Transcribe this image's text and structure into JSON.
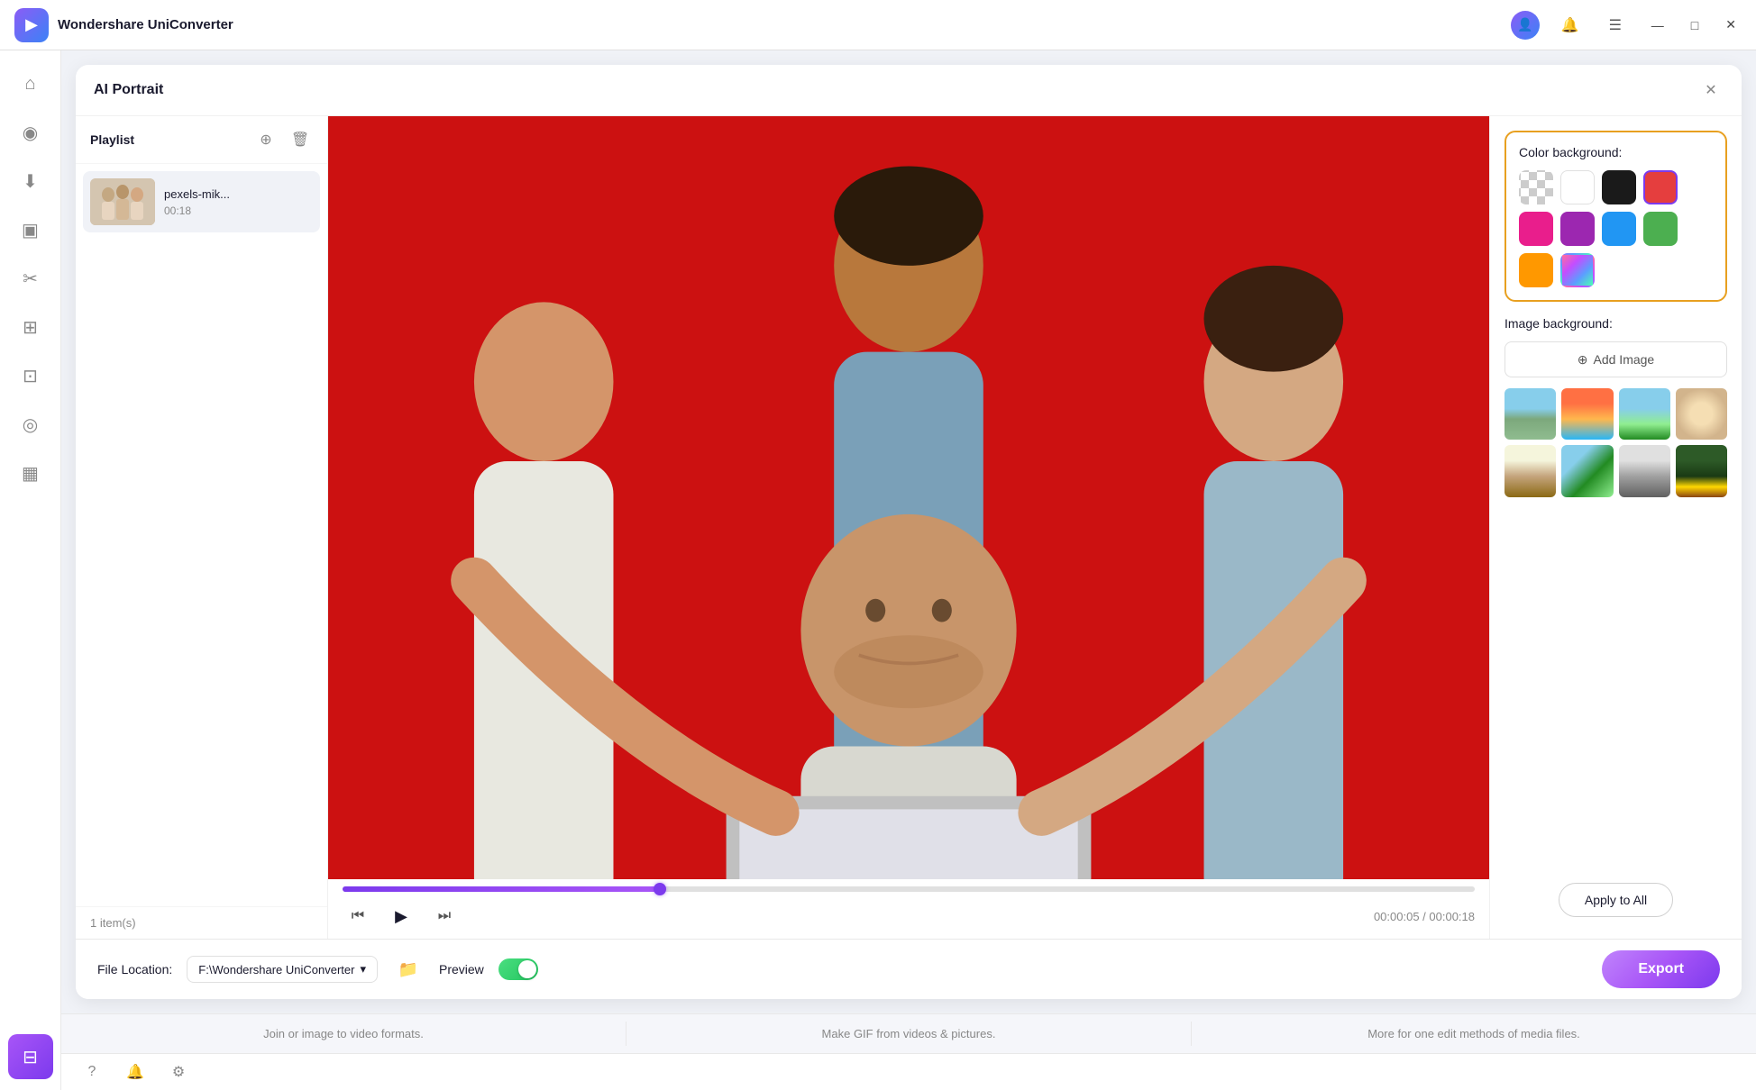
{
  "app": {
    "title": "Wondershare UniConverter",
    "logo_icon": "▶"
  },
  "titlebar": {
    "account_icon": "👤",
    "bell_icon": "🔔",
    "menu_icon": "☰",
    "minimize": "—",
    "maximize": "□",
    "close": "✕"
  },
  "sidebar": {
    "items": [
      {
        "id": "home",
        "icon": "⌂",
        "active": false
      },
      {
        "id": "camera",
        "icon": "◉",
        "active": false
      },
      {
        "id": "download",
        "icon": "⬇",
        "active": false
      },
      {
        "id": "video",
        "icon": "▣",
        "active": false
      },
      {
        "id": "scissors",
        "icon": "✂",
        "active": false
      },
      {
        "id": "grid4",
        "icon": "⊞",
        "active": false
      },
      {
        "id": "screenshot",
        "icon": "⊡",
        "active": false
      },
      {
        "id": "target",
        "icon": "◎",
        "active": false
      },
      {
        "id": "tv",
        "icon": "▦",
        "active": false
      },
      {
        "id": "tools",
        "icon": "⊟",
        "active": true
      }
    ]
  },
  "dialog": {
    "title": "AI Portrait",
    "close_label": "✕"
  },
  "playlist": {
    "title": "Playlist",
    "add_icon": "⊕",
    "delete_icon": "🗑",
    "items": [
      {
        "name": "pexels-mik...",
        "duration": "00:18"
      }
    ],
    "count": "1 item(s)"
  },
  "video": {
    "progress_percent": 28,
    "time_current": "00:00:05",
    "time_total": "00:00:18",
    "time_display": "00:00:05 / 00:00:18",
    "prev_icon": "⏮",
    "play_icon": "▶",
    "next_icon": "⏭"
  },
  "settings": {
    "color_bg_label": "Color background:",
    "image_bg_label": "Image background:",
    "add_image_label": "Add Image",
    "add_image_icon": "⊕",
    "colors": [
      {
        "id": "checkered",
        "type": "checkered",
        "label": "transparent"
      },
      {
        "id": "white",
        "hex": "#ffffff",
        "label": "white"
      },
      {
        "id": "black",
        "hex": "#1a1a1a",
        "label": "black"
      },
      {
        "id": "red",
        "hex": "#e53e3e",
        "label": "red",
        "selected": true
      },
      {
        "id": "pink",
        "hex": "#e91e8c",
        "label": "pink"
      },
      {
        "id": "purple",
        "hex": "#9c27b0",
        "label": "purple"
      },
      {
        "id": "blue",
        "hex": "#2196f3",
        "label": "blue"
      },
      {
        "id": "green",
        "hex": "#4caf50",
        "label": "green"
      },
      {
        "id": "orange",
        "hex": "#ff9800",
        "label": "orange"
      },
      {
        "id": "gradient",
        "type": "gradient",
        "label": "gradient"
      }
    ],
    "apply_all_label": "Apply to All"
  },
  "bottom_bar": {
    "file_location_label": "File Location:",
    "file_location_value": "F:\\Wondershare UniConverter",
    "preview_label": "Preview",
    "export_label": "Export"
  },
  "info_bar": {
    "items": [
      "Join or image to video formats.",
      "Make GIF from videos & pictures.",
      "More for one edit methods of media files."
    ]
  },
  "status_bar": {
    "help_icon": "?",
    "bell_icon": "🔔",
    "settings_icon": "⚙"
  }
}
